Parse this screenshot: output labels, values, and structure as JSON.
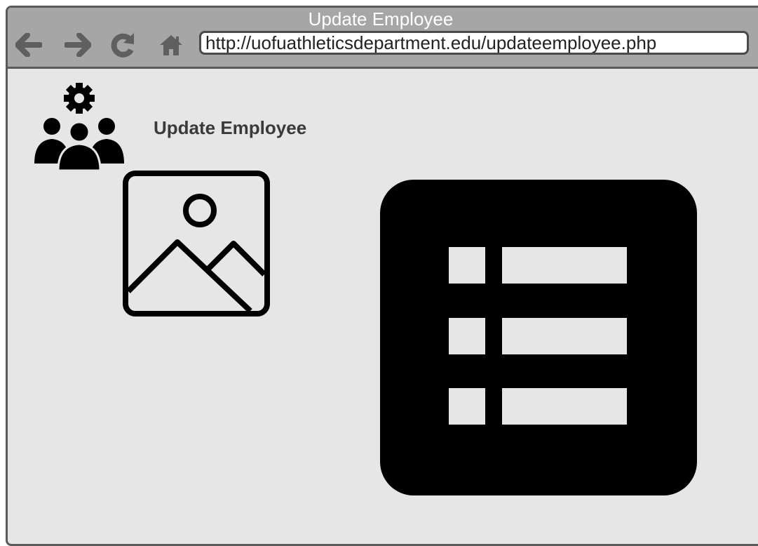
{
  "browser": {
    "window_title": "Update Employee",
    "url": "http://uofuathleticsdepartment.edu/updateemployee.php",
    "nav_icons": [
      "back-arrow-icon",
      "forward-arrow-icon",
      "reload-icon",
      "home-icon"
    ]
  },
  "page": {
    "heading": "Update Employee",
    "header_icon": "team-settings-icon",
    "image_placeholder_icon": "image-placeholder-icon",
    "details_icon": "list-icon"
  },
  "colors": {
    "titlebar": "#a6a6a6",
    "window_border": "#5a5a5a",
    "page_background": "#e6e6e6",
    "nav_icon": "#5f5f5f",
    "heading_text": "#3a3a3a",
    "icon_fill": "#000000"
  }
}
